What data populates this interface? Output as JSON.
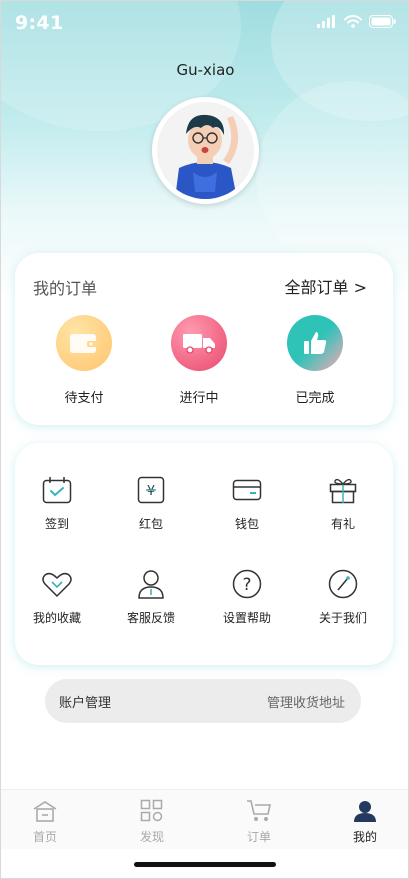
{
  "status_bar": {
    "time": "9:41"
  },
  "profile": {
    "username": "Gu-xiao"
  },
  "orders": {
    "title": "我的订单",
    "all_label": "全部订单",
    "items": [
      {
        "label": "待支付",
        "icon": "wallet-icon",
        "color": "#ffd27a"
      },
      {
        "label": "进行中",
        "icon": "truck-icon",
        "color": "#ff6d8a"
      },
      {
        "label": "已完成",
        "icon": "thumbs-up-icon",
        "color": "#2fc3b8"
      }
    ]
  },
  "tools": {
    "row1": [
      {
        "label": "签到",
        "icon": "calendar-check-icon"
      },
      {
        "label": "红包",
        "icon": "red-packet-icon"
      },
      {
        "label": "钱包",
        "icon": "card-icon"
      },
      {
        "label": "有礼",
        "icon": "gift-icon"
      }
    ],
    "row2": [
      {
        "label": "我的收藏",
        "icon": "heart-icon"
      },
      {
        "label": "客服反馈",
        "icon": "person-icon"
      },
      {
        "label": "设置帮助",
        "icon": "question-icon"
      },
      {
        "label": "关于我们",
        "icon": "compass-icon"
      }
    ]
  },
  "account": {
    "left_label": "账户管理",
    "right_label": "管理收货地址"
  },
  "tab_bar": {
    "tabs": [
      {
        "label": "首页",
        "icon": "home-icon",
        "active": false
      },
      {
        "label": "发现",
        "icon": "discover-icon",
        "active": false
      },
      {
        "label": "订单",
        "icon": "cart-icon",
        "active": false
      },
      {
        "label": "我的",
        "icon": "user-icon",
        "active": true
      }
    ]
  },
  "colors": {
    "accent": "#2fc3b8",
    "header_teal": "#9fdde0",
    "icon_teal": "#3bb5b8"
  }
}
